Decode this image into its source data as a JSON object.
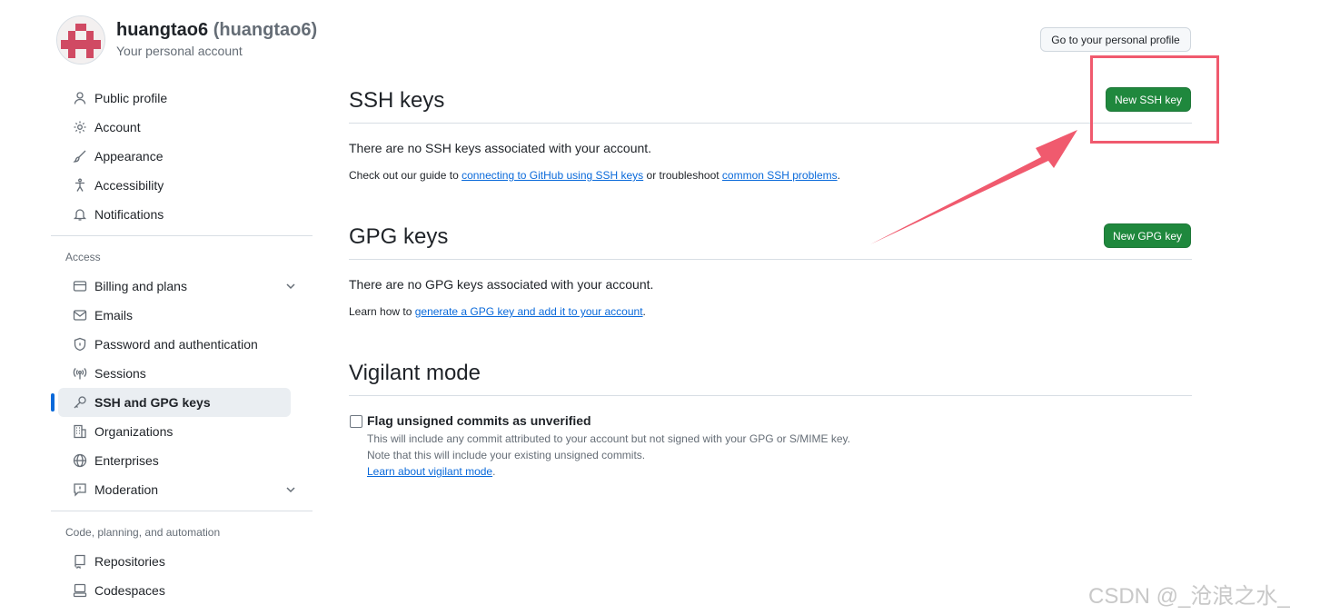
{
  "header": {
    "name": "huangtao6",
    "login": "(huangtao6)",
    "subtitle": "Your personal account",
    "profile_button": "Go to your personal profile"
  },
  "sidebar": {
    "items_top": [
      {
        "label": "Public profile",
        "icon": "person-icon"
      },
      {
        "label": "Account",
        "icon": "gear-icon"
      },
      {
        "label": "Appearance",
        "icon": "paintbrush-icon"
      },
      {
        "label": "Accessibility",
        "icon": "accessibility-icon"
      },
      {
        "label": "Notifications",
        "icon": "bell-icon"
      }
    ],
    "access_label": "Access",
    "items_access": [
      {
        "label": "Billing and plans",
        "icon": "credit-card-icon"
      },
      {
        "label": "Emails",
        "icon": "mail-icon"
      },
      {
        "label": "Password and authentication",
        "icon": "shield-lock-icon"
      },
      {
        "label": "Sessions",
        "icon": "broadcast-icon"
      },
      {
        "label": "SSH and GPG keys",
        "icon": "key-icon"
      },
      {
        "label": "Organizations",
        "icon": "organization-icon"
      },
      {
        "label": "Enterprises",
        "icon": "globe-icon"
      },
      {
        "label": "Moderation",
        "icon": "report-icon"
      }
    ],
    "code_label": "Code, planning, and automation",
    "items_code": [
      {
        "label": "Repositories",
        "icon": "repo-icon"
      },
      {
        "label": "Codespaces",
        "icon": "codespaces-icon"
      }
    ]
  },
  "ssh": {
    "title": "SSH keys",
    "button": "New SSH key",
    "empty": "There are no SSH keys associated with your account.",
    "guide_prefix": "Check out our guide to ",
    "guide_link": "connecting to GitHub using SSH keys",
    "guide_middle": " or troubleshoot ",
    "guide_link2": "common SSH problems",
    "guide_suffix": "."
  },
  "gpg": {
    "title": "GPG keys",
    "button": "New GPG key",
    "empty": "There are no GPG keys associated with your account.",
    "learn_prefix": "Learn how to ",
    "learn_link": "generate a GPG key and add it to your account",
    "learn_suffix": "."
  },
  "vigilant": {
    "title": "Vigilant mode",
    "checkbox_label": "Flag unsigned commits as unverified",
    "note1": "This will include any commit attributed to your account but not signed with your GPG or S/MIME key.",
    "note2": "Note that this will include your existing unsigned commits.",
    "learn_link": "Learn about vigilant mode",
    "learn_suffix": "."
  },
  "watermark": "CSDN @_沧浪之水_",
  "colors": {
    "accent": "#0969da",
    "primary_button": "#1f883d",
    "annotation": "#f05a6e"
  }
}
